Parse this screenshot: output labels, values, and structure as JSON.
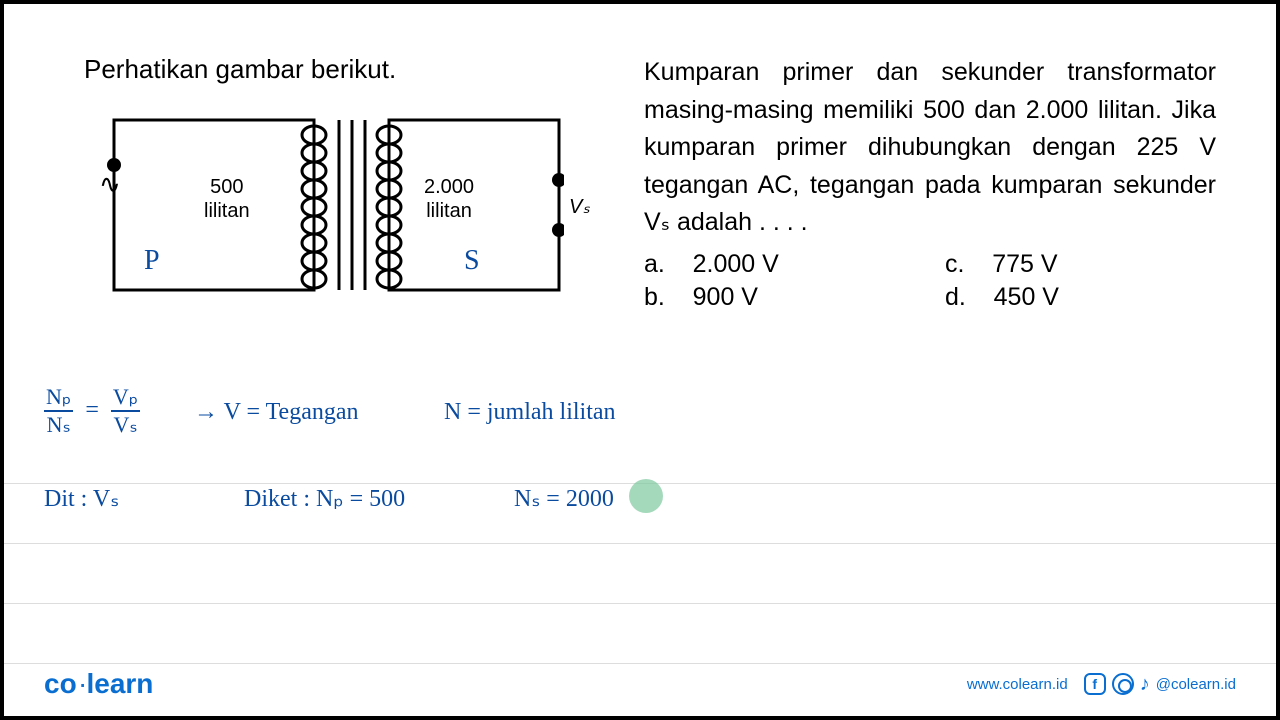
{
  "instruction": "Perhatikan gambar berikut.",
  "diagram": {
    "primary_coil_value": "500",
    "primary_coil_label": "lilitan",
    "secondary_coil_value": "2.000",
    "secondary_coil_label": "lilitan",
    "output_label": "Vₛ",
    "primary_annotation": "P",
    "secondary_annotation": "S",
    "ac_symbol": "∿"
  },
  "question_text": "Kumparan primer dan sekunder transformator masing-masing memiliki 500 dan 2.000 lilitan. Jika kumparan primer dihubungkan dengan 225 V tegangan AC, tegangan pada kumparan sekunder Vₛ adalah . . . .",
  "options": {
    "a": "a.    2.000 V",
    "c": "c.    775 V",
    "b": "b.    900 V",
    "d": "d.    450 V"
  },
  "handwriting": {
    "frac_np": "Nₚ",
    "frac_ns": "Nₛ",
    "frac_vp": "Vₚ",
    "frac_vs": "Vₛ",
    "eq1": "→  V = Tegangan",
    "eq2": "N = jumlah lilitan",
    "dit": "Dit :  Vₛ",
    "diket": "Diket :  Nₚ = 500",
    "ns_val": "Nₛ = 2000"
  },
  "footer": {
    "logo_part1": "co",
    "logo_part2": "learn",
    "website": "www.colearn.id",
    "handle": "@colearn.id"
  }
}
